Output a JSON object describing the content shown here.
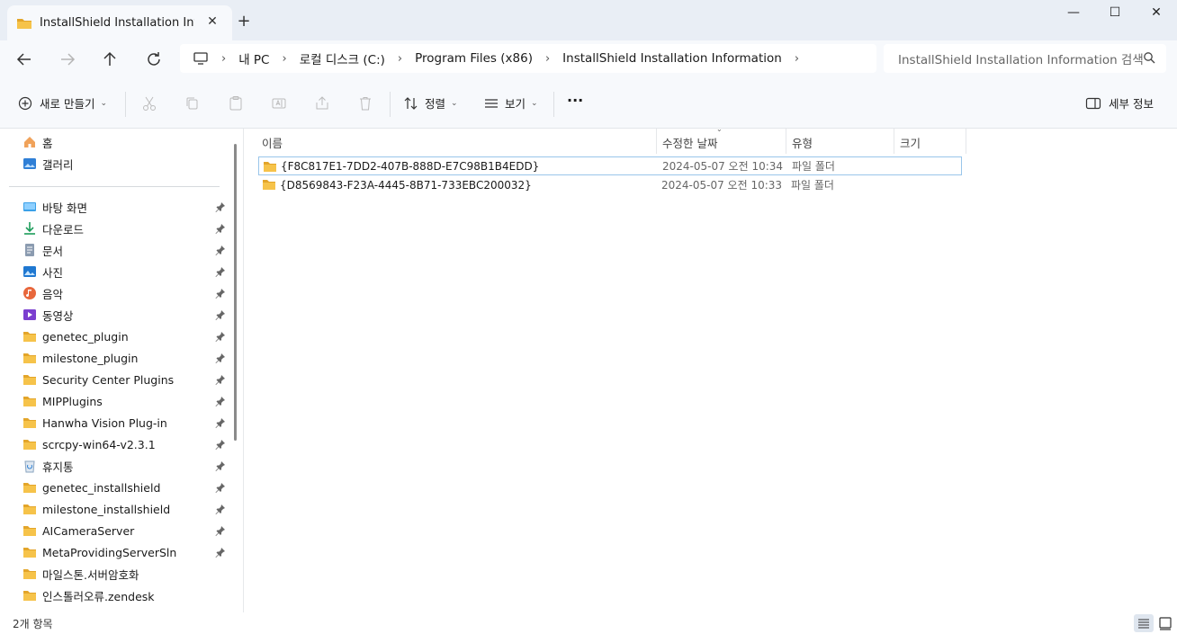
{
  "tab": {
    "title": "InstallShield Installation Info",
    "close": "✕",
    "new_tab": "+"
  },
  "window_controls": {
    "minimize": "—",
    "maximize": "☐",
    "close": "✕"
  },
  "nav": {
    "breadcrumb": [
      "내 PC",
      "로컬 디스크 (C:)",
      "Program Files (x86)",
      "InstallShield Installation Information"
    ],
    "separator": "›",
    "search_placeholder": "InstallShield Installation Information 검색"
  },
  "commands": {
    "new": "새로 만들기",
    "sort": "정렬",
    "view": "보기",
    "more": "···",
    "details": "세부 정보"
  },
  "sidebar": {
    "top": [
      {
        "label": "홈",
        "icon": "home-icon"
      },
      {
        "label": "갤러리",
        "icon": "gallery-icon"
      }
    ],
    "pinned": [
      {
        "label": "바탕 화면",
        "icon": "desktop-icon"
      },
      {
        "label": "다운로드",
        "icon": "download-icon"
      },
      {
        "label": "문서",
        "icon": "documents-icon"
      },
      {
        "label": "사진",
        "icon": "pictures-icon"
      },
      {
        "label": "음악",
        "icon": "music-icon"
      },
      {
        "label": "동영상",
        "icon": "videos-icon"
      },
      {
        "label": "genetec_plugin",
        "icon": "folder-icon"
      },
      {
        "label": "milestone_plugin",
        "icon": "folder-icon"
      },
      {
        "label": "Security Center Plugins",
        "icon": "folder-icon"
      },
      {
        "label": "MIPPlugins",
        "icon": "folder-icon"
      },
      {
        "label": "Hanwha Vision Plug-in",
        "icon": "folder-icon"
      },
      {
        "label": "scrcpy-win64-v2.3.1",
        "icon": "folder-icon"
      },
      {
        "label": "휴지통",
        "icon": "recycle-bin-icon"
      },
      {
        "label": "genetec_installshield",
        "icon": "folder-icon"
      },
      {
        "label": "milestone_installshield",
        "icon": "folder-icon"
      },
      {
        "label": "AICameraServer",
        "icon": "folder-icon"
      },
      {
        "label": "MetaProvidingServerSln",
        "icon": "folder-icon"
      },
      {
        "label": "마일스톤.서버암호화",
        "icon": "folder-icon"
      },
      {
        "label": "인스톨러오류.zendesk",
        "icon": "folder-icon"
      }
    ]
  },
  "columns": {
    "name": "이름",
    "modified": "수정한 날짜",
    "type": "유형",
    "size": "크기"
  },
  "files": [
    {
      "name": "{F8C817E1-7DD2-407B-888D-E7C98B1B4EDD}",
      "modified": "2024-05-07 오전 10:34",
      "type": "파일 폴더",
      "selected": true
    },
    {
      "name": "{D8569843-F23A-4445-8B71-733EBC200032}",
      "modified": "2024-05-07 오전 10:33",
      "type": "파일 폴더",
      "selected": false
    }
  ],
  "status": {
    "item_count": "2개 항목"
  },
  "colors": {
    "folder": "#f6c34a",
    "folder_dark": "#e3a52a",
    "selection_border": "#99c5ea",
    "chrome": "#e9eef5",
    "toolbar": "#f7f9fc"
  }
}
